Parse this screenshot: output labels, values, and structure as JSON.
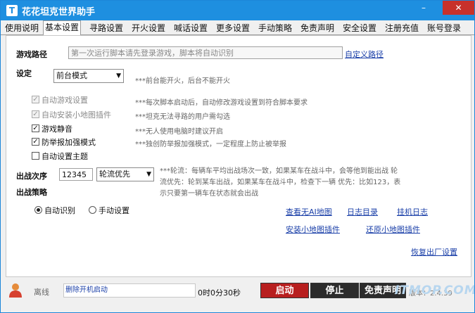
{
  "app": {
    "title": "花花坦克世界助手",
    "icon_letter": "T",
    "min": "–",
    "close": "✕"
  },
  "tabs": [
    "使用说明",
    "基本设置",
    "寻路设置",
    "开火设置",
    "喊话设置",
    "更多设置",
    "手动策略",
    "免责声明",
    "安全设置",
    "注册充值",
    "账号登录"
  ],
  "active_tab": "基本设置",
  "game_path": {
    "label": "游戏路径",
    "placeholder": "第一次运行脚本请先登录游戏，脚本将自动识别",
    "custom_link": "自定义路径"
  },
  "settings": {
    "label": "设定",
    "mode_value": "前台模式",
    "mode_hint": "***前台能开火，后台不能开火"
  },
  "options": [
    {
      "label": "自动游戏设置",
      "checked": true,
      "disabled": true,
      "hint": "***每次脚本启动后，自动修改游戏设置到符合脚本要求"
    },
    {
      "label": "自动安装小地图插件",
      "checked": true,
      "disabled": true,
      "hint": "***坦克无法寻路的用户需勾选"
    },
    {
      "label": "游戏静音",
      "checked": true,
      "disabled": false,
      "hint": "***无人使用电脑时建议开启"
    },
    {
      "label": "防举报加强模式",
      "checked": true,
      "disabled": false,
      "hint": "***独创防举报加强模式，一定程度上防止被举报"
    },
    {
      "label": "自动设置主题",
      "checked": false,
      "disabled": false,
      "hint": ""
    }
  ],
  "battle_order": {
    "label": "出战次序",
    "value": "12345",
    "mode_value": "轮流优先",
    "hint_line1": "***轮流：每辆车平均出战场次一致，如果某车在战斗中，会等他到能出战    轮",
    "hint_line2": "流优先：轮到某车出战，如果某车在战斗中，检查下一辆     优先：比如123，表",
    "hint_line3": "示只要第一辆车在状态就会出战"
  },
  "battle_strategy": {
    "label": "出战策略",
    "auto_label": "自动识别",
    "manual_label": "手动设置",
    "selected": "自动识别"
  },
  "links": {
    "view_no_ai_map": "查看无AI地图",
    "log_dir": "日志目录",
    "hang_log": "挂机日志",
    "install_minimap": "安装小地图插件",
    "restore_minimap": "还原小地图插件",
    "factory_reset": "恢复出厂设置"
  },
  "status": {
    "state": "离线",
    "message": "删除开机启动",
    "timer": "0时0分30秒",
    "start": "启动",
    "stop": "停止",
    "disclaimer": "免责声明",
    "version": "版本：2.4.39"
  },
  "watermark": "ITMOP.COM"
}
